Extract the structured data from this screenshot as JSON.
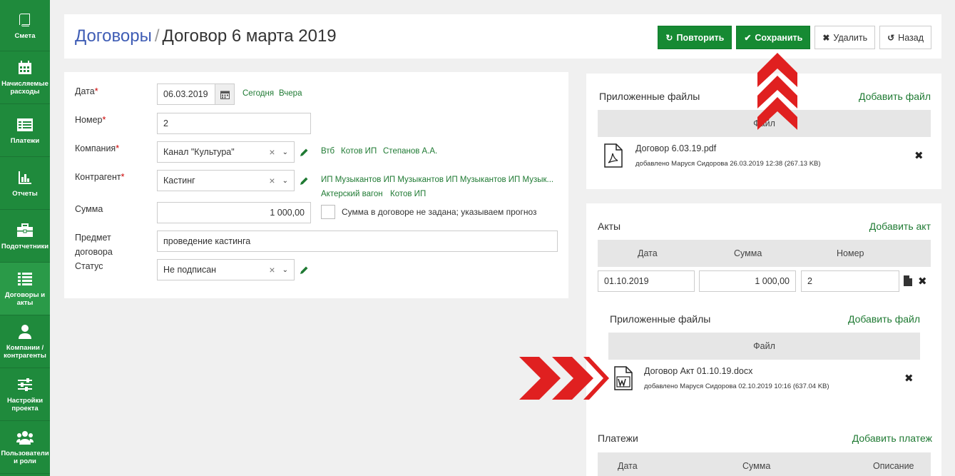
{
  "sidebar": {
    "items": [
      {
        "label": "Смета"
      },
      {
        "label": "Начисляемые расходы"
      },
      {
        "label": "Платежи"
      },
      {
        "label": "Отчеты"
      },
      {
        "label": "Подотчетники"
      },
      {
        "label": "Договоры и акты"
      },
      {
        "label": "Компании / контрагенты"
      },
      {
        "label": "Настройки проекта"
      },
      {
        "label": "Пользователи и роли"
      }
    ]
  },
  "header": {
    "breadcrumb": "Договоры",
    "separator": "/",
    "title": "Договор 6 марта 2019",
    "buttons": {
      "repeat": "Повторить",
      "save": "Сохранить",
      "delete": "Удалить",
      "back": "Назад"
    }
  },
  "form": {
    "date": {
      "label": "Дата",
      "value": "06.03.2019",
      "quick": [
        "Сегодня",
        "Вчера"
      ]
    },
    "number": {
      "label": "Номер",
      "value": "2"
    },
    "company": {
      "label": "Компания",
      "value": "Канал \"Культура\"",
      "quick": [
        "Втб",
        "Котов ИП",
        "Степанов А.А."
      ]
    },
    "counterparty": {
      "label": "Контрагент",
      "value": "Кастинг",
      "quick_line1": "ИП Музыкантов ИП Музыкантов ИП Музыкантов ИП Музык...",
      "quick": [
        "Актерский вагон",
        "Котов ИП"
      ]
    },
    "amount": {
      "label": "Сумма",
      "value": "1 000,00",
      "checkbox_label": "Сумма в договоре не задана; указываем прогноз"
    },
    "subject": {
      "label_line1": "Предмет",
      "label_line2": "договора",
      "value": "проведение кастинга"
    },
    "status": {
      "label": "Статус",
      "value": "Не подписан"
    }
  },
  "attached_files": {
    "title": "Приложенные файлы",
    "add": "Добавить файл",
    "column": "Файл",
    "files": [
      {
        "name": "Договор 6.03.19.pdf",
        "meta": "добавлено Маруся Сидорова 26.03.2019 12:38 (267.13 KB)",
        "icon": "pdf-file-icon"
      }
    ]
  },
  "acts": {
    "title": "Акты",
    "add": "Добавить акт",
    "columns": [
      "Дата",
      "Сумма",
      "Номер"
    ],
    "rows": [
      {
        "date": "01.10.2019",
        "amount": "1 000,00",
        "number": "2"
      }
    ],
    "files": {
      "title": "Приложенные файлы",
      "add": "Добавить файл",
      "column": "Файл",
      "items": [
        {
          "name": "Договор Акт 01.10.19.docx",
          "meta": "добавлено Маруся Сидорова 02.10.2019 10:16 (637.04 KB)",
          "icon": "word-file-icon"
        }
      ]
    }
  },
  "payments": {
    "title": "Платежи",
    "add": "Добавить платеж",
    "columns": [
      "Дата",
      "Сумма",
      "Описание"
    ]
  },
  "colors": {
    "sidebar": "#1f8a3c",
    "accent": "#168a33",
    "link": "#3f5db5",
    "arrow": "#e02020"
  }
}
